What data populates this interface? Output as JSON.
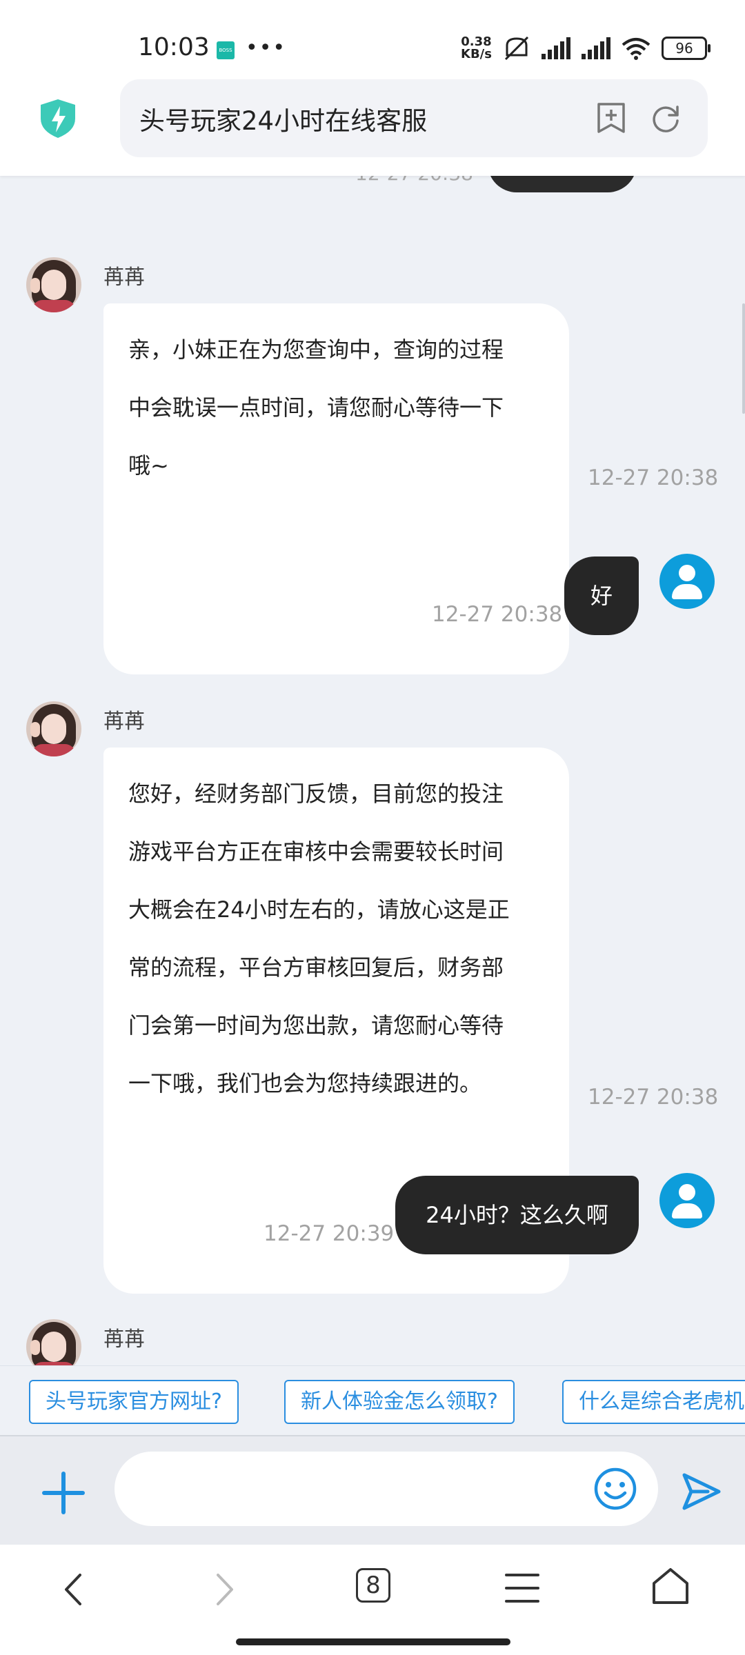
{
  "status_bar": {
    "time": "10:03",
    "boss_badge": "BOSS直聘",
    "net_speed_value": "0.38",
    "net_speed_unit": "KB/s",
    "battery": "96"
  },
  "header": {
    "title": "头号玩家24小时在线客服"
  },
  "chat": {
    "top_partial_time": "12-27 20:38",
    "messages": [
      {
        "sender": "agent",
        "name": "苒苒",
        "lines": [
          "亲，小妹正在为您查询中，查询的过程",
          "中会耽误一点时间，请您耐心等待一下",
          "哦~"
        ],
        "time": "12-27 20:38"
      },
      {
        "sender": "user",
        "text": "好",
        "time": "12-27 20:38"
      },
      {
        "sender": "agent",
        "name": "苒苒",
        "lines": [
          "您好，经财务部门反馈，目前您的投注",
          "游戏平台方正在审核中会需要较长时间",
          "大概会在24小时左右的，请放心这是正",
          "常的流程，平台方审核回复后，财务部",
          "门会第一时间为您出款，请您耐心等待",
          "一下哦，我们也会为您持续跟进的。"
        ],
        "time": "12-27 20:38"
      },
      {
        "sender": "user",
        "text": "24小时？这么久啊",
        "time": "12-27 20:39"
      },
      {
        "sender": "agent",
        "name": "苒苒"
      }
    ]
  },
  "quick_questions": [
    "头号玩家官方网址?",
    "新人体验金怎么领取?",
    "什么是综合老虎机"
  ],
  "input": {
    "placeholder": ""
  },
  "nav": {
    "tab_count": "8"
  }
}
